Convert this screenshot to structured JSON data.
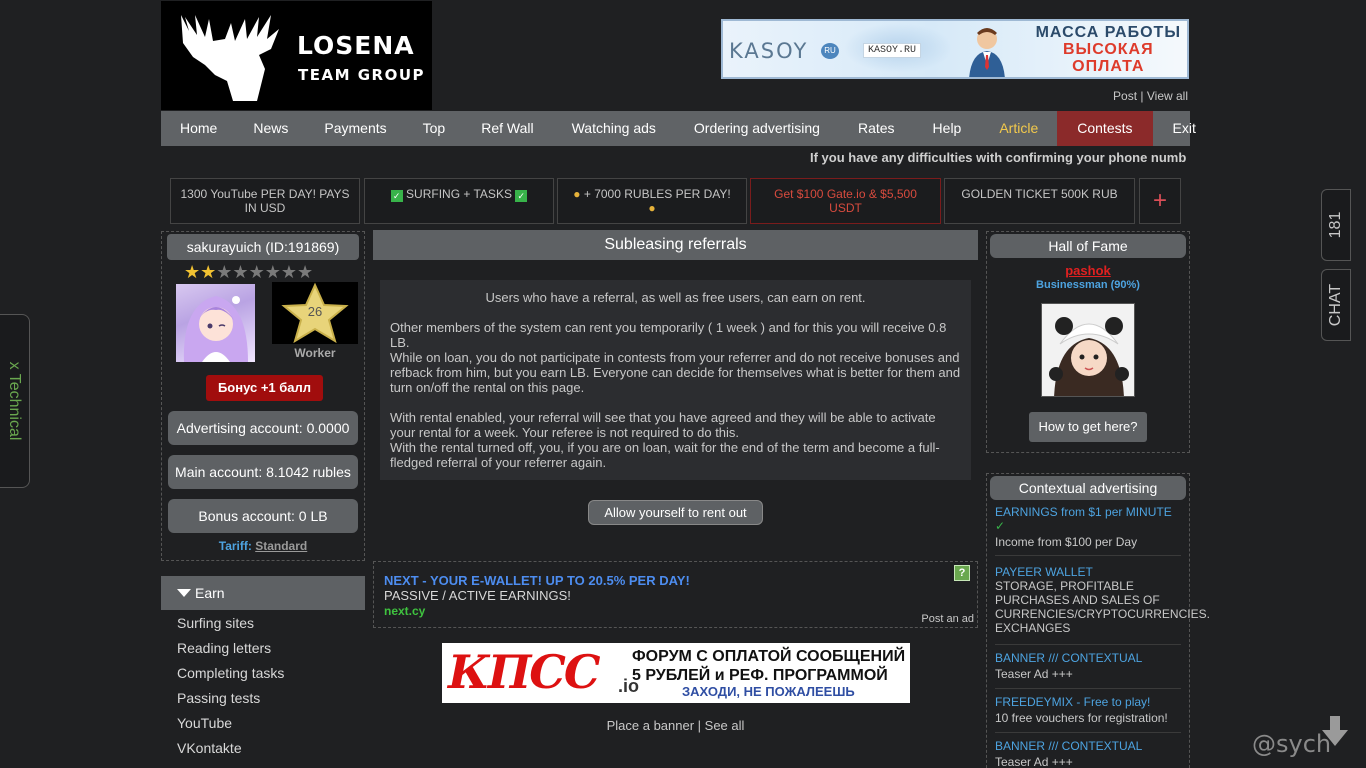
{
  "header": {
    "logo_line1": "LOSENA",
    "logo_line2": "TEAM GROUP",
    "banner": {
      "brand": "KASOY",
      "brand_badge": "RU",
      "site_chip": "KASOY.RU",
      "line1": "МАССА РАБОТЫ",
      "line2": "ВЫСОКАЯ",
      "line3": "ОПЛАТА"
    },
    "post_label": "Post",
    "view_all_label": "View all"
  },
  "nav": [
    {
      "label": "Home"
    },
    {
      "label": "News"
    },
    {
      "label": "Payments"
    },
    {
      "label": "Top"
    },
    {
      "label": "Ref Wall"
    },
    {
      "label": "Watching ads"
    },
    {
      "label": "Ordering advertising"
    },
    {
      "label": "Rates"
    },
    {
      "label": "Help"
    },
    {
      "label": "Article"
    },
    {
      "label": "Contests"
    },
    {
      "label": "Exit"
    }
  ],
  "ticker": "If you have any difficulties with confirming your phone numb",
  "promos": [
    {
      "text": "1300 YouTube PER DAY! PAYS IN USD"
    },
    {
      "text": "SURFING + TASKS"
    },
    {
      "text": "+ 7000 RUBLES PER DAY!"
    },
    {
      "text": "Get $100 Gate.io & $5,500 USDT"
    },
    {
      "text": "GOLDEN TICKET 500K RUB"
    }
  ],
  "promo_plus": "+",
  "user": {
    "name": "sakurayuich (ID:191869)",
    "stars_total": 8,
    "stars_on": 2,
    "level": "26",
    "level_title": "Worker",
    "bonus_button": "Бонус +1 балл",
    "advertising_account": "Advertising account: 0.0000",
    "main_account": "Main account: 8.1042 rubles",
    "bonus_account": "Bonus account: 0 LB",
    "tariff_label": "Tariff:",
    "tariff_value": "Standard"
  },
  "earn_menu": {
    "title": "Earn",
    "items": [
      "Surfing sites",
      "Reading letters",
      "Completing tasks",
      "Passing tests",
      "YouTube",
      "VKontakte"
    ]
  },
  "main": {
    "title": "Subleasing referrals",
    "p1": "Users who have a referral, as well as free users, can earn on rent.",
    "p2": "Other members of the system can rent you temporarily ( 1 week ) and for this you will receive 0.8 LB.",
    "p3": "While on loan, you do not participate in contests from your referrer and do not receive bonuses and refback from him, but you earn LB. Everyone can decide for themselves what is better for them and turn on/off the rental on this page.",
    "p4": "With rental enabled, your referral will see that you have agreed and they will be able to activate your rental for a week. Your referee is not required to do this.",
    "p5": "With the rental turned off, you, if you are on loan, wait for the end of the term and become a full-fledged referral of your referrer again.",
    "rent_button": "Allow yourself to rent out"
  },
  "text_ad": {
    "title": "NEXT - YOUR E-WALLET! UP TO 20.5% PER DAY!",
    "desc": "PASSIVE / ACTIVE EARNINGS!",
    "url": "next.cy",
    "help": "?",
    "post_label": "Post an ad"
  },
  "banner2": {
    "logo": "КПСС",
    "logo_suffix": ".io",
    "line1": "ФОРУМ С ОПЛАТОЙ СООБЩЕНИЙ",
    "line2": "5 РУБЛЕЙ и РЕФ. ПРОГРАММОЙ",
    "line3": "ЗАХОДИ, НЕ ПОЖАЛЕЕШЬ"
  },
  "place_banner": "Place a banner",
  "see_all": "See all",
  "hall_of_fame": {
    "title": "Hall of Fame",
    "name": "pashok",
    "rank": "Businessman (90%)",
    "button": "How to get here?"
  },
  "contextual": {
    "title": "Contextual advertising",
    "items": [
      {
        "title": "EARNINGS from $1 per MINUTE",
        "desc": "Income from $100 per Day"
      },
      {
        "title": "PAYEER WALLET",
        "desc": "STORAGE, PROFITABLE PURCHASES AND SALES OF CURRENCIES/CRYPTOCURRENCIES. EXCHANGES"
      },
      {
        "title": "BANNER /// CONTEXTUAL",
        "desc": "Teaser Ad +++"
      },
      {
        "title": "FREEDEYMIX - Free to play!",
        "desc": "10 free vouchers for registration!"
      },
      {
        "title": "BANNER /// CONTEXTUAL",
        "desc": "Teaser Ad +++"
      }
    ]
  },
  "side": {
    "online_count": "181",
    "chat_label": "CHAT",
    "technical_label": "x Technical",
    "watermark": "@sych"
  },
  "colors": {
    "accent_red": "#8b2a2a",
    "link_blue": "#4da3e0",
    "article_yellow": "#f2c94c"
  }
}
